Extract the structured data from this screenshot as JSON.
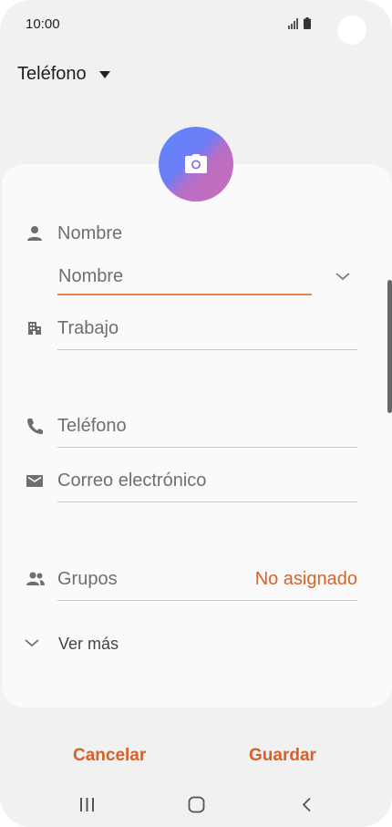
{
  "status_bar": {
    "time": "10:00"
  },
  "account": {
    "label": "Teléfono"
  },
  "form": {
    "name_label": "Nombre",
    "name_field_placeholder": "Nombre",
    "work_placeholder": "Trabajo",
    "phone_placeholder": "Teléfono",
    "email_placeholder": "Correo electrónico",
    "groups_label": "Grupos",
    "groups_value": "No asignado",
    "more_label": "Ver más"
  },
  "actions": {
    "cancel": "Cancelar",
    "save": "Guardar"
  },
  "colors": {
    "accent": "#d6632a",
    "underline_active": "#e6834c",
    "background": "#f1f1f1",
    "card": "#fafafa"
  },
  "icons": [
    "person-icon",
    "building-icon",
    "phone-icon",
    "mail-icon",
    "groups-icon",
    "chevron-down-icon",
    "camera-icon",
    "recents-icon",
    "home-icon",
    "back-icon"
  ]
}
